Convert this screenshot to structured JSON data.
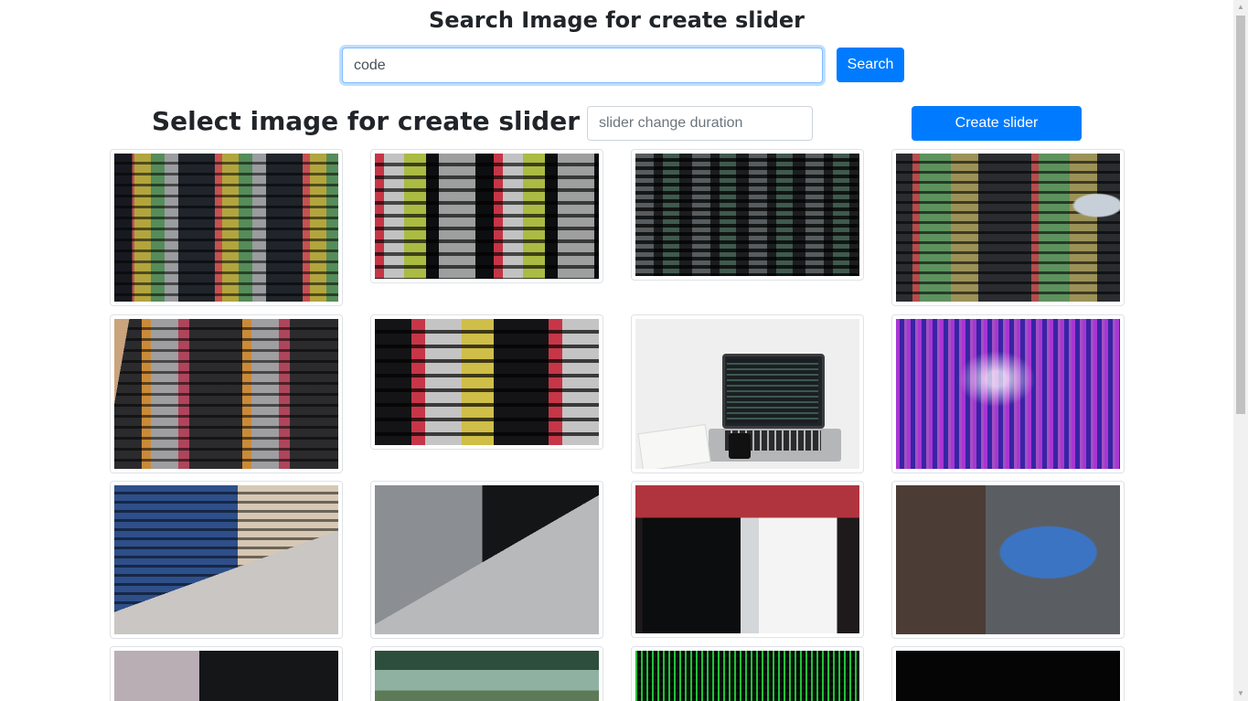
{
  "search": {
    "title": "Search Image for create slider",
    "input_value": "code",
    "button_label": "Search"
  },
  "slider": {
    "title": "Select image for create slider",
    "duration_placeholder": "slider change duration",
    "create_button_label": "Create slider"
  },
  "scrollbar": {
    "up_icon": "▲",
    "down_icon": "▼"
  }
}
